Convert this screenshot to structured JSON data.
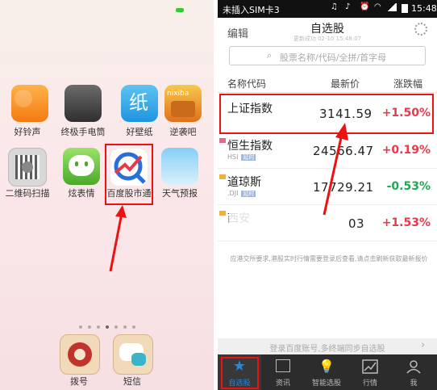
{
  "home": {
    "apps_row1": [
      {
        "label": "好铃声",
        "icon": "ringtone-icon"
      },
      {
        "label": "终极手电筒",
        "icon": "flashlight-icon"
      },
      {
        "label": "好壁纸",
        "icon": "wallpaper-icon",
        "glyph": "纸"
      },
      {
        "label": "逆袭吧",
        "icon": "nixiba-icon",
        "glyph": "nixiba"
      }
    ],
    "apps_row2": [
      {
        "label": "二维码扫描",
        "icon": "qr-scanner-icon"
      },
      {
        "label": "炫表情",
        "icon": "emoji-icon"
      },
      {
        "label": "百度股市通",
        "icon": "baidu-stock-icon"
      },
      {
        "label": "天气预报",
        "icon": "weather-icon"
      }
    ],
    "dock": [
      {
        "label": "拨号",
        "icon": "dialer-icon"
      },
      {
        "label": "短信",
        "icon": "sms-icon"
      }
    ]
  },
  "statusbar": {
    "carrier": "未插入SIM卡3",
    "time": "15:48"
  },
  "navbar": {
    "edit": "编辑",
    "title": "自选股",
    "subtitle": "更新成功 02-10 15:48:07"
  },
  "search": {
    "placeholder": "股票名称/代码/全拼/首字母"
  },
  "columns": {
    "name": "名称代码",
    "price": "最新价",
    "change": "涨跌幅"
  },
  "stocks": [
    {
      "name": "上证指数",
      "code": "",
      "tag": "",
      "price": "3141.59",
      "change": "+1.50%",
      "up": true
    },
    {
      "name": "恒生指数",
      "code": "HSI",
      "tag": "延时",
      "price": "24566.47",
      "change": "+0.19%",
      "up": true
    },
    {
      "name": "道琼斯",
      "code": ".DJI",
      "tag": "延时",
      "price": "17729.21",
      "change": "-0.53%",
      "up": false
    },
    {
      "name": "西安",
      "code": "",
      "tag": "",
      "price": "03",
      "change": "+1.53%",
      "up": true
    }
  ],
  "note": "应港交所要求,港股实时行情需要登录后查看,请点击刷新获取最新报价",
  "login_prompt": "登录百度账号,多终端同步自选股",
  "tabs": [
    {
      "label": "自选股",
      "icon": "star-icon"
    },
    {
      "label": "资讯",
      "icon": "news-icon"
    },
    {
      "label": "智能选股",
      "icon": "lightbulb-icon"
    },
    {
      "label": "行情",
      "icon": "market-chart-icon"
    },
    {
      "label": "我",
      "icon": "user-icon"
    }
  ],
  "colors": {
    "up": "#e8394a",
    "down": "#1fa84f",
    "highlight": "#ee1111",
    "accent": "#2a86d9"
  }
}
